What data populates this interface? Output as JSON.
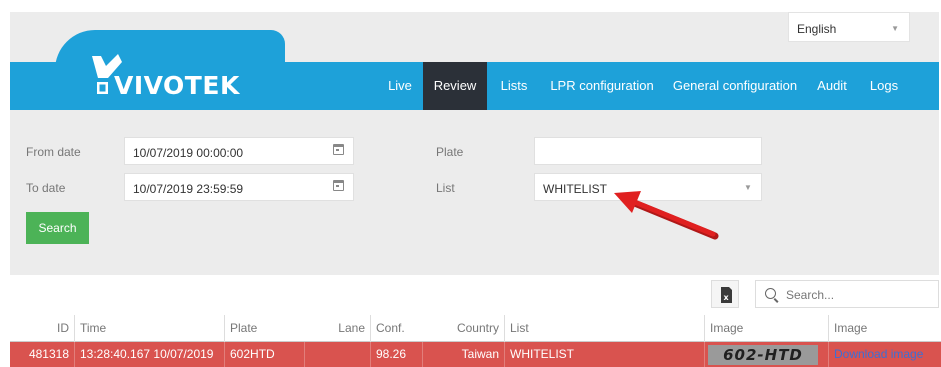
{
  "language": {
    "selected": "English"
  },
  "brand": {
    "name": "VIVOTEK"
  },
  "nav": [
    {
      "label": "Live",
      "active": false
    },
    {
      "label": "Review",
      "active": true
    },
    {
      "label": "Lists",
      "active": false
    },
    {
      "label": "LPR configuration",
      "active": false
    },
    {
      "label": "General configuration",
      "active": false
    },
    {
      "label": "Audit",
      "active": false
    },
    {
      "label": "Logs",
      "active": false
    }
  ],
  "filters": {
    "from_label": "From date",
    "from_value": "10/07/2019 00:00:00",
    "to_label": "To date",
    "to_value": "10/07/2019 23:59:59",
    "plate_label": "Plate",
    "plate_value": "",
    "list_label": "List",
    "list_value": "WHITELIST",
    "search_button": "Search"
  },
  "table_tools": {
    "search_placeholder": "Search..."
  },
  "table": {
    "columns": [
      "ID",
      "Time",
      "Plate",
      "Lane",
      "Conf.",
      "Country",
      "List",
      "Image",
      "Image"
    ],
    "rows": [
      {
        "id": "481318",
        "time": "13:28:40.167 10/07/2019",
        "plate": "602HTD",
        "lane": "",
        "conf": "98.26",
        "country": "Taiwan",
        "list": "WHITELIST",
        "image_text": "602-HTD",
        "image_link": "Download image"
      }
    ]
  },
  "colors": {
    "navbar": "#1ea1d9",
    "active_tab": "#2b3038",
    "search_button": "#4cb357",
    "highlight_row": "#d9534f",
    "arrow": "#e02020"
  }
}
